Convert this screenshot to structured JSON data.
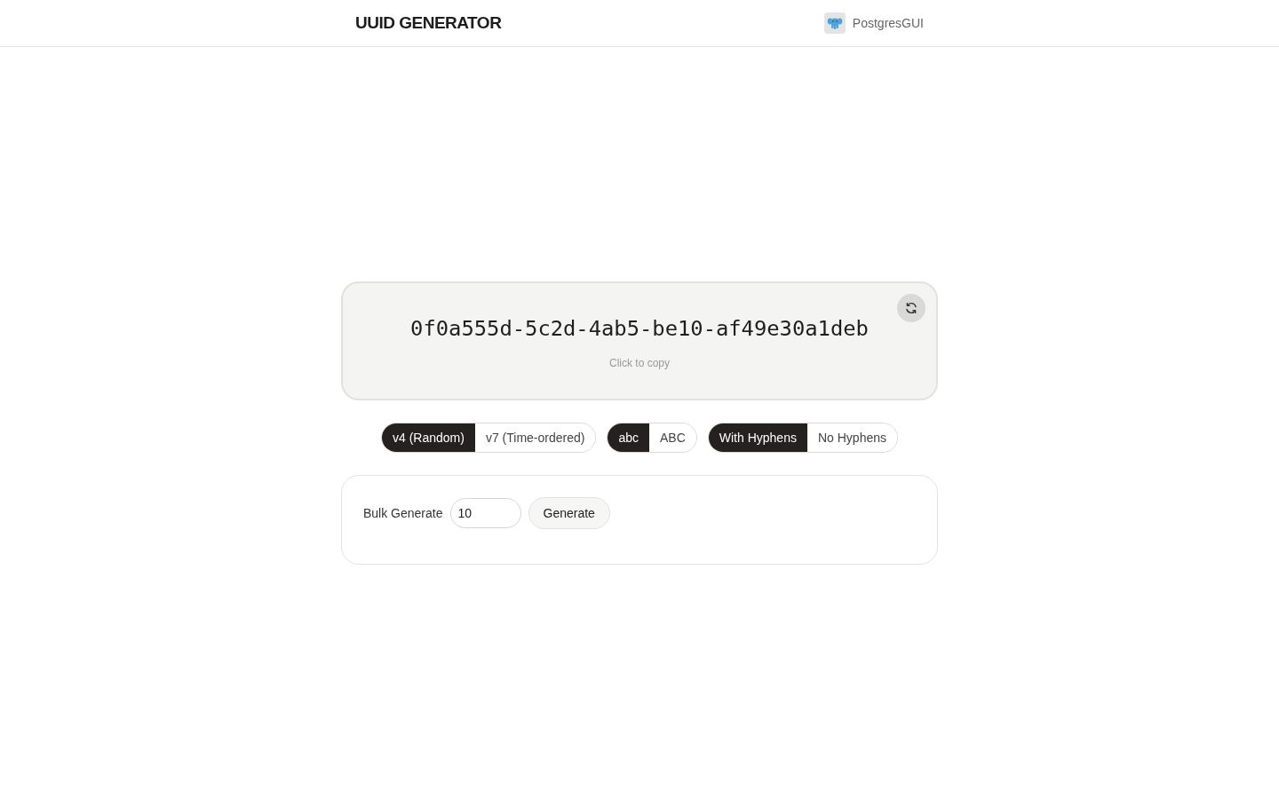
{
  "header": {
    "title": "UUID GENERATOR",
    "link": {
      "label": "PostgresGUI"
    }
  },
  "uuid_display": {
    "value": "0f0a555d-5c2d-4ab5-be10-af49e30a1deb",
    "hint": "Click to copy"
  },
  "option_groups": [
    {
      "options": [
        {
          "label": "v4 (Random)",
          "selected": true
        },
        {
          "label": "v7 (Time-ordered)",
          "selected": false
        }
      ]
    },
    {
      "options": [
        {
          "label": "abc",
          "selected": true
        },
        {
          "label": "ABC",
          "selected": false
        }
      ]
    },
    {
      "options": [
        {
          "label": "With Hyphens",
          "selected": true
        },
        {
          "label": "No Hyphens",
          "selected": false
        }
      ]
    }
  ],
  "bulk": {
    "label": "Bulk Generate",
    "input": {
      "value": "10"
    },
    "button": "Generate"
  }
}
